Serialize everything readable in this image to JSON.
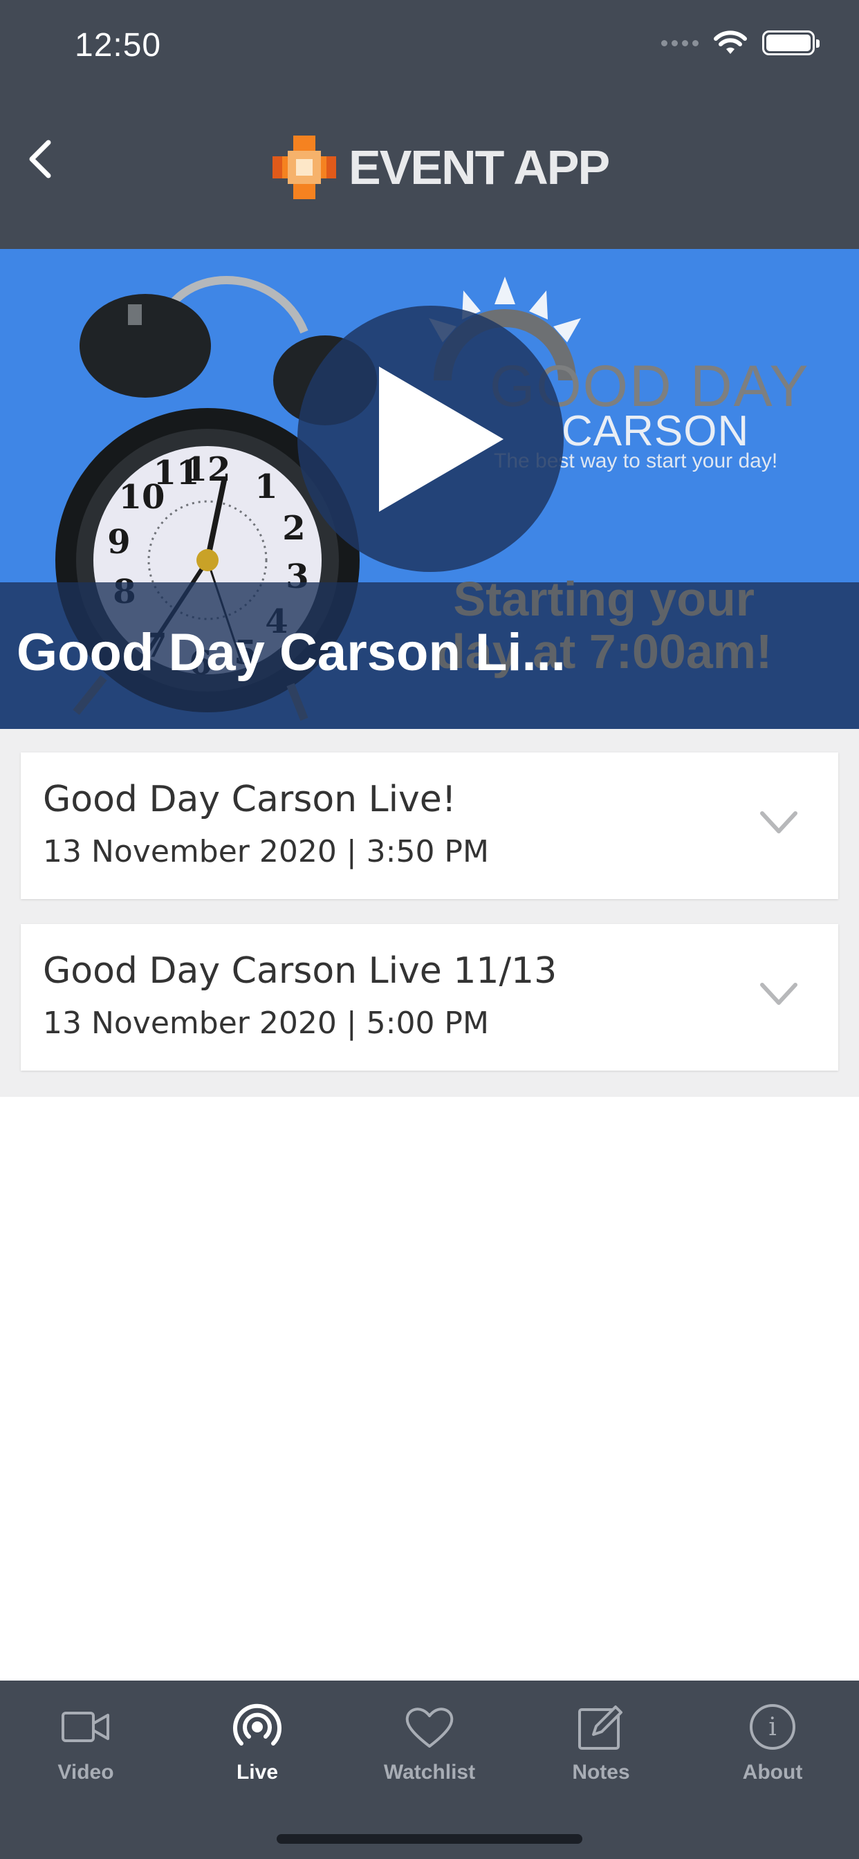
{
  "status_bar": {
    "time": "12:50"
  },
  "header": {
    "logo_text": "EVENT APP"
  },
  "hero": {
    "title": "Good Day Carson Li...",
    "image_text": {
      "brand_line1": "GOOD DAY",
      "brand_line2": "CARSON",
      "tagline": "The best way to start your day!",
      "starting_line1": "Starting your",
      "starting_line2": "day at 7:00am!"
    }
  },
  "sessions": [
    {
      "title": "Good Day Carson Live!",
      "date": "13 November 2020 | 3:50 PM"
    },
    {
      "title": "Good Day Carson Live 11/13",
      "date": "13 November 2020 | 5:00 PM"
    }
  ],
  "tabs": [
    {
      "label": "Video",
      "icon": "video-icon",
      "active": false
    },
    {
      "label": "Live",
      "icon": "live-icon",
      "active": true
    },
    {
      "label": "Watchlist",
      "icon": "heart-icon",
      "active": false
    },
    {
      "label": "Notes",
      "icon": "notes-icon",
      "active": false
    },
    {
      "label": "About",
      "icon": "info-icon",
      "active": false
    }
  ],
  "colors": {
    "header_bg": "#434a55",
    "hero_bg": "#3f86e6",
    "list_bg": "#efeff0",
    "tab_active": "#ffffff",
    "tab_inactive": "#a8adb5",
    "logo_orange": "#f58220"
  }
}
